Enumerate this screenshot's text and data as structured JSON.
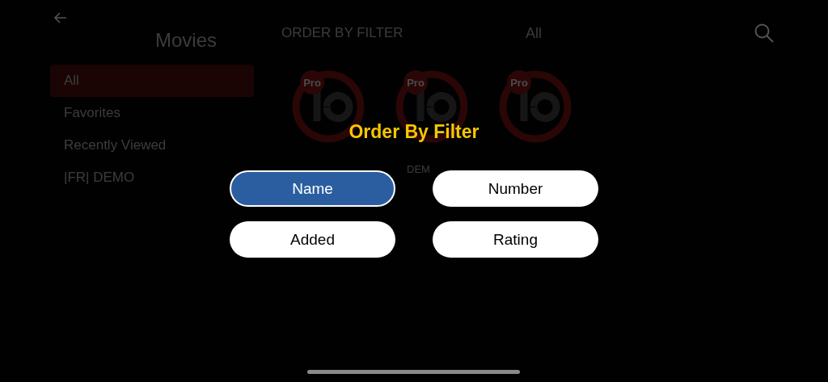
{
  "sidebar": {
    "title": "Movies",
    "items": [
      {
        "label": "All",
        "selected": true
      },
      {
        "label": "Favorites",
        "selected": false
      },
      {
        "label": "Recently Viewed",
        "selected": false
      },
      {
        "label": "|FR| DEMO",
        "selected": false
      }
    ]
  },
  "header": {
    "title": "ORDER BY FILTER",
    "category": "All"
  },
  "cards": [
    {
      "badge": "Pro"
    },
    {
      "badge": "Pro",
      "caption": "DEM"
    },
    {
      "badge": "Pro"
    }
  ],
  "dialog": {
    "title": "Order By Filter",
    "options": [
      {
        "label": "Name",
        "selected": true
      },
      {
        "label": "Number",
        "selected": false
      },
      {
        "label": "Added",
        "selected": false
      },
      {
        "label": "Rating",
        "selected": false
      }
    ]
  }
}
